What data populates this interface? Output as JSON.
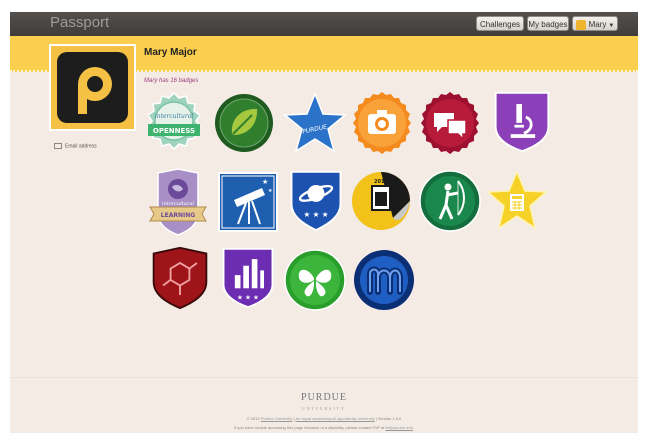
{
  "app": {
    "brand": "Passport",
    "nav": {
      "challenges": "Challenges",
      "my_badges": "My badges",
      "user": "Mary"
    }
  },
  "profile": {
    "name": "Mary Major",
    "badge_count": "Mary has 16 badges",
    "email_label": "Email address"
  },
  "badges": [
    {
      "name": "Intercultural Openness",
      "icon": "ribbon-openness-badge",
      "text": [
        "intercultural",
        "OPENNESS"
      ]
    },
    {
      "name": "Leaf",
      "icon": "leaf-badge"
    },
    {
      "name": "Star",
      "icon": "star-badge",
      "text": [
        "PURDUE"
      ]
    },
    {
      "name": "Camera",
      "icon": "camera-badge"
    },
    {
      "name": "Discussion",
      "icon": "speech-bubbles-badge"
    },
    {
      "name": "Microscope",
      "icon": "microscope-shield-badge"
    },
    {
      "name": "Intercultural Learning",
      "icon": "ribbon-learning-badge",
      "text": [
        "intercultural",
        "LEARNING"
      ]
    },
    {
      "name": "Telescope",
      "icon": "telescope-badge"
    },
    {
      "name": "Planet",
      "icon": "planet-shield-badge"
    },
    {
      "name": "2012 Sticker",
      "icon": "sticker-badge",
      "text": [
        "2012"
      ]
    },
    {
      "name": "Archer",
      "icon": "archer-badge"
    },
    {
      "name": "Calculator",
      "icon": "calculator-star-badge"
    },
    {
      "name": "Molecule",
      "icon": "molecule-shield-badge"
    },
    {
      "name": "Bar Chart",
      "icon": "bar-chart-badge"
    },
    {
      "name": "Butterfly",
      "icon": "butterfly-badge"
    },
    {
      "name": "Mixable",
      "icon": "m-logo-badge"
    }
  ],
  "footer": {
    "logo": "PURDUE",
    "logo_sub": "UNIVERSITY",
    "copyright_prefix": "© 2012 ",
    "university_link": "Purdue University",
    "separator1": " | ",
    "eeo_link": "An equal access/equal opportunity university",
    "version": " | Version 1.5.0",
    "accessibility_prefix": "If you have trouble accessing this page because of a disability, please contact PoP at ",
    "contact_link": "tlt@purdue.edu",
    "accessibility_suffix": "."
  }
}
